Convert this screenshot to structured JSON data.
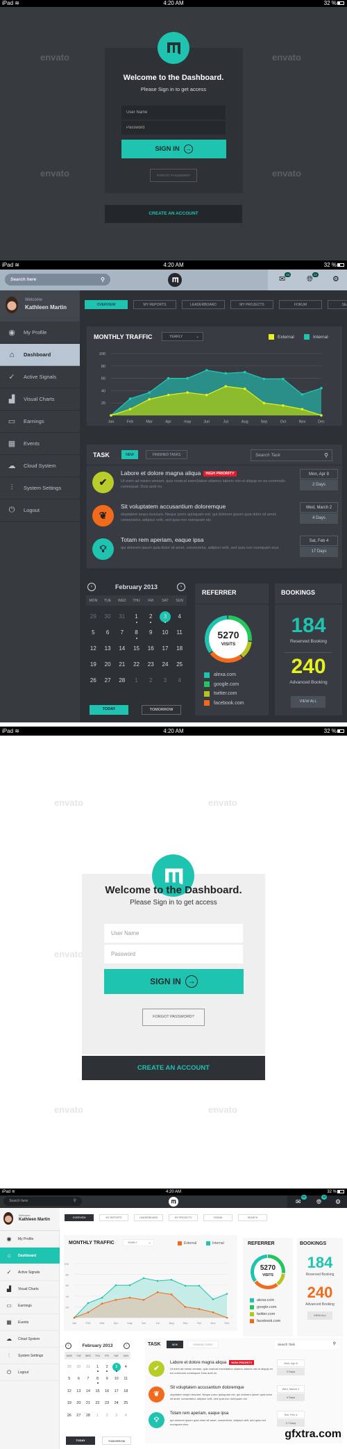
{
  "statusbar": {
    "device": "iPad",
    "wifi_icon": "wifi-icon",
    "time": "4:20 AM",
    "battery": "32 %"
  },
  "watermark": "envato",
  "login": {
    "logo_letter": "m",
    "title": "Welcome to the Dashboard.",
    "subtitle": "Please Sign in to get access",
    "username_placeholder": "User Name",
    "password_placeholder": "Password",
    "signin_label": "SIGN IN",
    "forgot_label": "FORGOT PASSWORD?",
    "create_label": "CREATE AN ACCOUNT"
  },
  "topbar": {
    "search_placeholder": "Search here",
    "messages_badge": "04",
    "notifications_badge": "12"
  },
  "user": {
    "welcome": "Welcome",
    "name": "Kathleen Martin"
  },
  "sidebar": {
    "items": [
      {
        "label": "My Profile",
        "icon": "user-icon"
      },
      {
        "label": "Dashboard",
        "icon": "home-icon",
        "active": true
      },
      {
        "label": "Active Signals",
        "icon": "check-circle-icon"
      },
      {
        "label": "Visual Charts",
        "icon": "bar-chart-icon"
      },
      {
        "label": "Earnings",
        "icon": "money-icon"
      },
      {
        "label": "Events",
        "icon": "calendar-icon"
      },
      {
        "label": "Cloud System",
        "icon": "cloud-icon"
      },
      {
        "label": "System Settings",
        "icon": "sliders-icon"
      },
      {
        "label": "Logout",
        "icon": "power-icon"
      }
    ]
  },
  "tabs": [
    "OVERVIEW",
    "MY REPORTS",
    "LEADERBOARD",
    "MY PROJECTS",
    "FORUM",
    "SEARCH"
  ],
  "traffic": {
    "title": "MONTHLY TRAFFIC",
    "period": "YEARLY",
    "legend_external": "External",
    "legend_internal": "Internal"
  },
  "chart_data": {
    "type": "area",
    "title": "MONTHLY TRAFFIC",
    "categories": [
      "Jan",
      "Feb",
      "Mar",
      "Apr",
      "may",
      "Jun",
      "Jul",
      "Aug",
      "Sep",
      "Oct",
      "Nov",
      "Dec"
    ],
    "yticks": [
      20,
      40,
      60,
      80,
      100
    ],
    "ylim": [
      0,
      100
    ],
    "grid": true,
    "legend": "top-right",
    "series": [
      {
        "name": "Internal",
        "values": [
          0,
          27,
          37,
          60,
          60,
          73,
          68,
          70,
          59,
          59,
          34,
          44
        ]
      },
      {
        "name": "External",
        "values": [
          0,
          10,
          26,
          33,
          37,
          33,
          47,
          43,
          20,
          16,
          10,
          0
        ]
      }
    ]
  },
  "task": {
    "title": "TASK",
    "new_label": "NEW",
    "finished_label": "FINISHED TASKS",
    "search_placeholder": "Search Task",
    "items": [
      {
        "title": "Labore et dolore magna aliqua",
        "badge": "HIGH PRIORITY",
        "desc": "Ut enim ad minim veniam, quis nostrud exercitation ullamco laboris nisi ut aliquip ex ea commodo consequat. Duis auté iru",
        "date": "Mon, Apr 8",
        "days": "2 Days",
        "icon": "check-icon"
      },
      {
        "title": "Sit voluptatem accusantium doloremque",
        "badge": "",
        "desc": "oluptatem sequi nesciunt. Neque porro quisquam est, qui dolorem ipsum quia dolor sit amet, consectetur, adipisci velit, sed quia non numquam eiu",
        "date": "Wed, March 2",
        "days": "4 Days",
        "icon": "leaf-icon"
      },
      {
        "title": "Totam rem aperiam, eaque ipsa",
        "badge": "",
        "desc": "qui dolorem ipsum quia dolor sit amet, consectetur, adipisci velit, sed quia non numquam eius",
        "date": "Sat, Feb 4",
        "days": "17 Days",
        "icon": "lightbulb-icon"
      }
    ]
  },
  "calendar": {
    "month": "February 2013",
    "weekdays": [
      "MON",
      "TUE",
      "WED",
      "THU",
      "FRI",
      "SAT",
      "SUN"
    ],
    "weeks": [
      [
        "29",
        "30",
        "31",
        "1",
        "2",
        "3",
        "4"
      ],
      [
        "5",
        "6",
        "7",
        "8",
        "9",
        "10",
        "11"
      ],
      [
        "12",
        "13",
        "14",
        "15",
        "16",
        "17",
        "18"
      ],
      [
        "19",
        "20",
        "21",
        "22",
        "23",
        "24",
        "25"
      ],
      [
        "26",
        "27",
        "28",
        "1",
        "2",
        "3",
        "4"
      ]
    ],
    "selected": "3",
    "event_days": [
      "1",
      "2",
      "3",
      "8"
    ],
    "today_label": "TODAY",
    "tomorrow_label": "TOMORROW"
  },
  "referrer": {
    "title": "REFERRER",
    "visits": "5270",
    "visits_label": "VISITS",
    "sources": [
      {
        "name": "alexa.com",
        "color": "#1ec4b0",
        "share": 35
      },
      {
        "name": "google.com",
        "color": "#22c55e",
        "share": 27
      },
      {
        "name": "twitter.com",
        "color": "#b5c41e",
        "share": 13
      },
      {
        "name": "facebook.com",
        "color": "#f26a1b",
        "share": 25
      }
    ]
  },
  "bookings": {
    "title": "BOOKINGS",
    "reserved": "184",
    "reserved_label": "Reserved Booking",
    "advanced": "240",
    "advanced_label": "Advanced Booking",
    "view_all": "VIEW ALL"
  },
  "colors": {
    "accent": "#1ec4b0",
    "external_dark": "#e5f21b",
    "external_light": "#f26a1b",
    "internal": "#1ec4b0",
    "priority": "#e51a2b"
  }
}
